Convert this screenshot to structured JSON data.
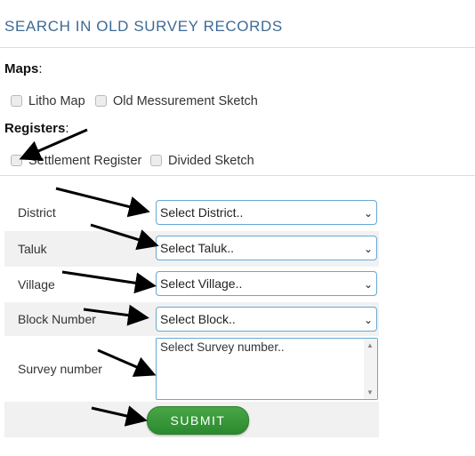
{
  "header": {
    "title": "SEARCH IN OLD SURVEY RECORDS"
  },
  "maps": {
    "label": "Maps",
    "colon": ":",
    "options": [
      "Litho Map",
      "Old Messurement Sketch"
    ]
  },
  "registers": {
    "label": "Registers",
    "colon": ":",
    "options": [
      "Settlement Register",
      "Divided Sketch"
    ]
  },
  "form": {
    "district": {
      "label": "District",
      "value": "Select District.."
    },
    "taluk": {
      "label": "Taluk",
      "value": "Select Taluk.."
    },
    "village": {
      "label": "Village",
      "value": "Select Village.."
    },
    "block": {
      "label": "Block Number",
      "value": "Select Block.."
    },
    "survey": {
      "label": "Survey number",
      "placeholder": "Select Survey number.."
    },
    "submit_label": "SUBMIT"
  },
  "colors": {
    "title": "#3d6a95",
    "submit": "#3a9a3b",
    "field_border": "#66a8d4"
  }
}
